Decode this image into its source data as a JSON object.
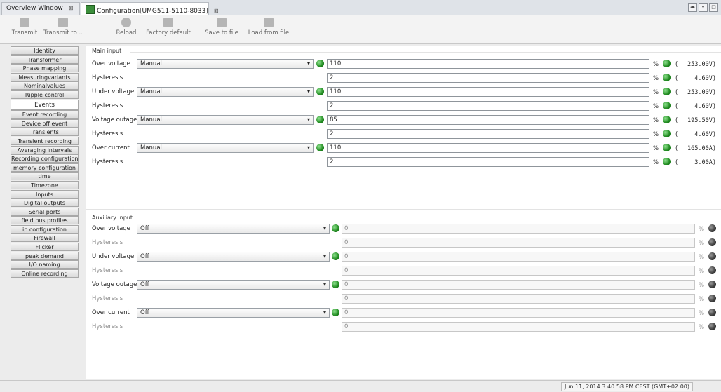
{
  "tabs": [
    {
      "label": "Overview Window",
      "close": "⊠"
    },
    {
      "label": "Configuration[UMG511-5110-8033]",
      "close": "⊠"
    }
  ],
  "toolbar": [
    "Transmit",
    "Transmit to ..",
    "Reload",
    "Factory default",
    "Save to file",
    "Load from file"
  ],
  "sidebar": [
    "Identity",
    "Transformer",
    "Phase mapping",
    "Measuringvariants",
    "Nominalvalues",
    "Ripple control",
    "Events",
    "Event recording",
    "Device off event",
    "Transients",
    "Transient recording",
    "Averaging intervals",
    "Recording configuration",
    "memory configuration",
    "time",
    "Timezone",
    "Inputs",
    "Digital outputs",
    "Serial ports",
    "field bus profiles",
    "ip configuration",
    "Firewall",
    "Flicker",
    "peak demand",
    "I/O naming",
    "Online recording"
  ],
  "main_input": {
    "title": "Main input",
    "rows": [
      {
        "label": "Over voltage",
        "select": "Manual",
        "value": "110",
        "unit": "%",
        "computed": "253.00V)"
      },
      {
        "label": "Hysteresis",
        "value": "2",
        "unit": "%",
        "computed": "4.60V)"
      },
      {
        "label": "Under voltage",
        "select": "Manual",
        "value": "110",
        "unit": "%",
        "computed": "253.00V)"
      },
      {
        "label": "Hysteresis",
        "value": "2",
        "unit": "%",
        "computed": "4.60V)"
      },
      {
        "label": "Voltage outage",
        "select": "Manual",
        "value": "85",
        "unit": "%",
        "computed": "195.50V)"
      },
      {
        "label": "Hysteresis",
        "value": "2",
        "unit": "%",
        "computed": "4.60V)"
      },
      {
        "label": "Over current",
        "select": "Manual",
        "value": "110",
        "unit": "%",
        "computed": "165.00A)"
      },
      {
        "label": "Hysteresis",
        "value": "2",
        "unit": "%",
        "computed": "3.00A)"
      }
    ]
  },
  "aux_input": {
    "title": "Auxiliary input",
    "rows": [
      {
        "label": "Over voltage",
        "select": "Off",
        "value": "0",
        "unit": "%"
      },
      {
        "label": "Hysteresis",
        "value": "0",
        "unit": "%"
      },
      {
        "label": "Under voltage",
        "select": "Off",
        "value": "0",
        "unit": "%"
      },
      {
        "label": "Hysteresis",
        "value": "0",
        "unit": "%"
      },
      {
        "label": "Voltage outage",
        "select": "Off",
        "value": "0",
        "unit": "%"
      },
      {
        "label": "Hysteresis",
        "value": "0",
        "unit": "%"
      },
      {
        "label": "Over current",
        "select": "Off",
        "value": "0",
        "unit": "%"
      },
      {
        "label": "Hysteresis",
        "value": "0",
        "unit": "%"
      }
    ]
  },
  "paren_open": "(",
  "status_text": "Jun 11, 2014 3:40:58 PM CEST (GMT+02:00)",
  "colors": {
    "led_active": "#2e9e2e",
    "led_inactive": "#3b3b3b"
  }
}
